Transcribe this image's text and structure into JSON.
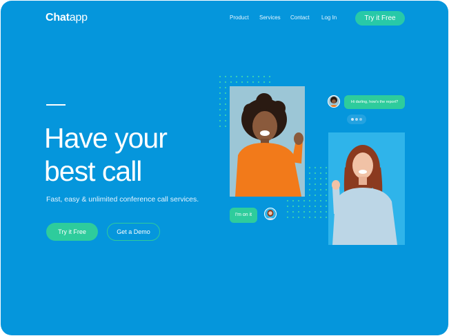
{
  "brand": {
    "logo_bold": "Chat",
    "logo_regular": "app"
  },
  "nav": {
    "items": [
      {
        "label": "Product"
      },
      {
        "label": "Services"
      },
      {
        "label": "Contact"
      },
      {
        "label": "Log In"
      }
    ],
    "cta_label": "Try it Free"
  },
  "hero": {
    "headline_line1": "Have your",
    "headline_line2": "best call",
    "subtitle": "Fast, easy & unlimited conference call services.",
    "primary_cta": "Try it Free",
    "secondary_cta": "Get a Demo"
  },
  "chat": {
    "message_incoming": "Hi darling, how's the report?",
    "message_outgoing": "I'm on it"
  },
  "colors": {
    "background": "#0596DC",
    "accent": "#2ECC9C"
  }
}
